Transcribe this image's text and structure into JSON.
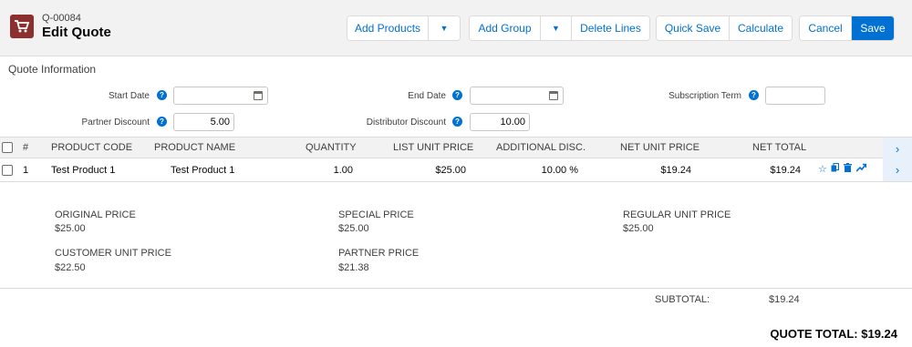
{
  "header": {
    "quote_number": "Q-00084",
    "title": "Edit Quote",
    "buttons": {
      "add_products": "Add Products",
      "add_group": "Add Group",
      "delete_lines": "Delete Lines",
      "quick_save": "Quick Save",
      "calculate": "Calculate",
      "cancel": "Cancel",
      "save": "Save"
    }
  },
  "quote_info": {
    "section_title": "Quote Information",
    "start_date": {
      "label": "Start Date",
      "value": ""
    },
    "end_date": {
      "label": "End Date",
      "value": ""
    },
    "subscription_term": {
      "label": "Subscription Term",
      "value": ""
    },
    "partner_discount": {
      "label": "Partner Discount",
      "value": "5.00"
    },
    "distributor_discount": {
      "label": "Distributor Discount",
      "value": "10.00"
    }
  },
  "table": {
    "columns": {
      "num": "#",
      "product_code": "PRODUCT CODE",
      "product_name": "PRODUCT NAME",
      "quantity": "QUANTITY",
      "list_unit_price": "LIST UNIT PRICE",
      "additional_disc": "ADDITIONAL DISC.",
      "net_unit_price": "NET UNIT PRICE",
      "net_total": "NET TOTAL"
    },
    "rows": [
      {
        "num": "1",
        "product_code": "Test Product 1",
        "product_name": "Test Product 1",
        "quantity": "1.00",
        "list_unit_price": "$25.00",
        "additional_disc": "10.00 %",
        "net_unit_price": "$19.24",
        "net_total": "$19.24"
      }
    ]
  },
  "details": {
    "original_price": {
      "label": "ORIGINAL PRICE",
      "value": "$25.00"
    },
    "special_price": {
      "label": "SPECIAL PRICE",
      "value": "$25.00"
    },
    "regular_unit_price": {
      "label": "REGULAR UNIT PRICE",
      "value": "$25.00"
    },
    "customer_unit_price": {
      "label": "CUSTOMER UNIT PRICE",
      "value": "$22.50"
    },
    "partner_price": {
      "label": "PARTNER PRICE",
      "value": "$21.38"
    }
  },
  "subtotal": {
    "label": "SUBTOTAL:",
    "value": "$19.24"
  },
  "quote_total": "QUOTE TOTAL: $19.24",
  "icons": {
    "logo": "shopping-cart-icon",
    "help": "question-icon",
    "calendar": "calendar-icon",
    "row_actions": [
      "star-icon",
      "copy-icon",
      "delete-icon",
      "trend-icon"
    ]
  },
  "colors": {
    "brand": "#0070d2",
    "logo_bg": "#8b2f2f",
    "header_bg": "#f3f2f2"
  }
}
